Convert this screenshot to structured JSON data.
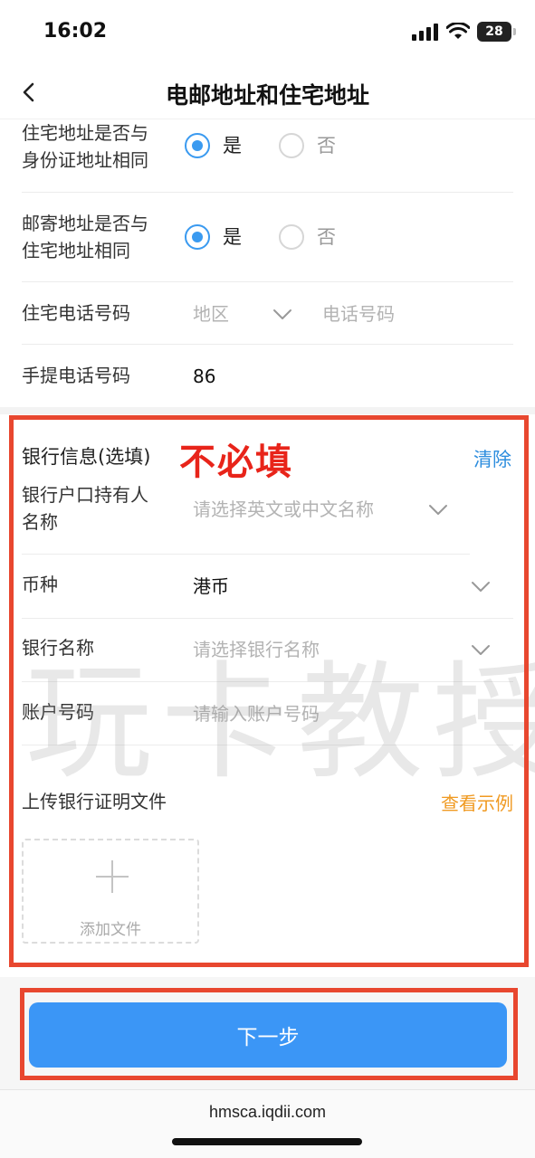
{
  "status_bar": {
    "time": "16:02",
    "battery": "28"
  },
  "nav": {
    "title": "电邮地址和住宅地址"
  },
  "residential_same_as_id": {
    "label_line1": "住宅地址是否与",
    "label_line2": "身份证地址相同",
    "yes": "是",
    "no": "否",
    "selected": "是"
  },
  "mailing_same_as_residential": {
    "label_line1": "邮寄地址是否与",
    "label_line2": "住宅地址相同",
    "yes": "是",
    "no": "否",
    "selected": "是"
  },
  "home_phone": {
    "label": "住宅电话号码",
    "region_placeholder": "地区",
    "number_placeholder": "电话号码"
  },
  "mobile_phone": {
    "label": "手提电话号码",
    "country_code": "86"
  },
  "bank_section": {
    "title": "银行信息(选填)",
    "note": "不必填",
    "clear": "清除",
    "holder": {
      "label_line1": "银行户口持有人",
      "label_line2": "名称",
      "placeholder": "请选择英文或中文名称"
    },
    "currency": {
      "label": "币种",
      "value": "港币"
    },
    "bank_name": {
      "label": "银行名称",
      "placeholder": "请选择银行名称"
    },
    "account": {
      "label": "账户号码",
      "placeholder": "请输入账户号码"
    },
    "upload": {
      "label": "上传银行证明文件",
      "sample_link": "查看示例",
      "add_file": "添加文件"
    }
  },
  "watermark": "玩卡教授",
  "next_button": "下一步",
  "url": "hmsca.iqdii.com",
  "colors": {
    "accent": "#3b96f6",
    "highlight": "#e8472f",
    "note": "#e8241a",
    "link_orange": "#f09a22"
  }
}
